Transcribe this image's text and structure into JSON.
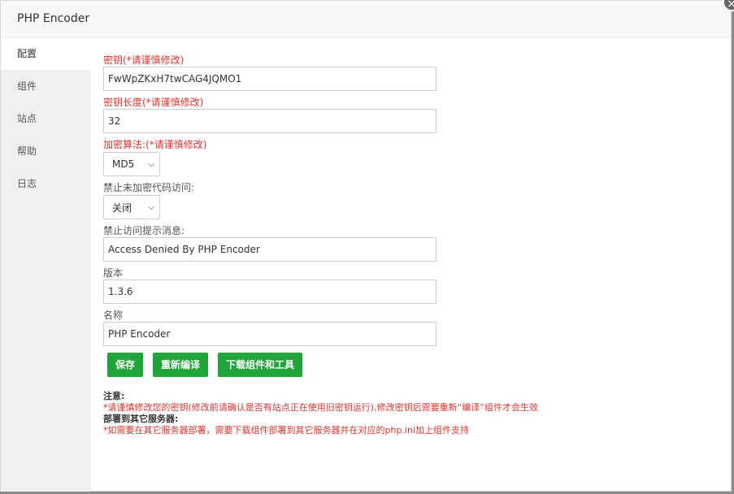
{
  "dialog": {
    "title": "PHP Encoder",
    "close_glyph": "×"
  },
  "sidebar": {
    "items": [
      {
        "label": "配置",
        "active": true
      },
      {
        "label": "组件",
        "active": false
      },
      {
        "label": "站点",
        "active": false
      },
      {
        "label": "帮助",
        "active": false
      },
      {
        "label": "日志",
        "active": false
      }
    ]
  },
  "form": {
    "key": {
      "label": "密钥(*请谨慎修改)",
      "value": "FwWpZKxH7twCAG4JQMO1"
    },
    "key_length": {
      "label": "密钥长度(*请谨慎修改)",
      "value": "32"
    },
    "algorithm": {
      "label": "加密算法:(*请谨慎修改)",
      "value": "MD5"
    },
    "deny_unencrypted": {
      "label": "禁止未加密代码访问:",
      "value": "关闭"
    },
    "deny_message": {
      "label": "禁止访问提示消息:",
      "value": "Access Denied By PHP Encoder"
    },
    "version": {
      "label": "版本",
      "value": "1.3.6"
    },
    "name": {
      "label": "名称",
      "value": "PHP Encoder"
    }
  },
  "buttons": {
    "save": "保存",
    "recompile": "重新编译",
    "download": "下载组件和工具"
  },
  "notes": {
    "heading1": "注意:",
    "text1": "*请谨慎修改您的密钥(修改前请确认是否有站点正在使用旧密钥运行),修改密钥后需要重新“编译”组件才会生效",
    "heading2": "部署到其它服务器:",
    "text2": "*如需要在其它服务器部署，需要下载组件部署到其它服务器并在对应的php.ini加上组件支持"
  },
  "colors": {
    "accent_green": "#20a53a",
    "warning_red": "#e5322d"
  }
}
